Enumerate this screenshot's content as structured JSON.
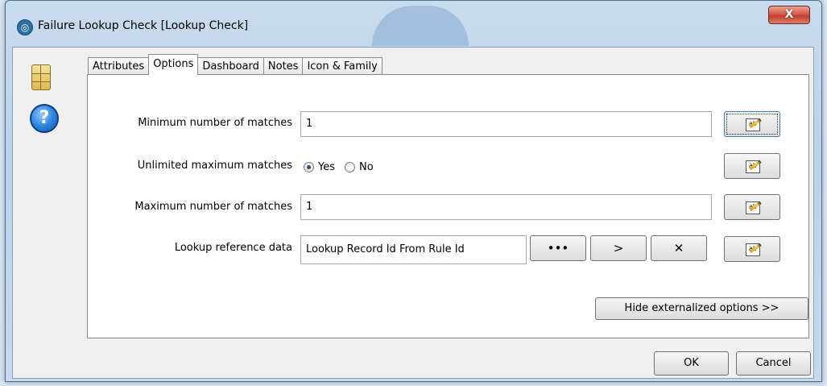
{
  "window": {
    "title": "Failure Lookup Check [Lookup Check]",
    "close_glyph": "X",
    "app_icon": "app-logo-icon"
  },
  "side_icons": {
    "db": "database-table-icon",
    "help": "?"
  },
  "tabs": [
    {
      "label": "Attributes",
      "active": false
    },
    {
      "label": "Options",
      "active": true
    },
    {
      "label": "Dashboard",
      "active": false
    },
    {
      "label": "Notes",
      "active": false
    },
    {
      "label": "Icon & Family",
      "active": false
    }
  ],
  "options": {
    "min_matches": {
      "label": "Minimum number of matches",
      "value": "1"
    },
    "unlimited_max": {
      "label": "Unlimited maximum matches",
      "yes_label": "Yes",
      "no_label": "No",
      "selected": "Yes"
    },
    "max_matches": {
      "label": "Maximum number of matches",
      "value": "1"
    },
    "lookup_ref": {
      "label": "Lookup reference data",
      "value": "Lookup Record Id From Rule Id",
      "browse": "•••",
      "go": ">",
      "clear": "✕"
    },
    "edit_glyph": "ab"
  },
  "hide_externalized": "Hide externalized options >>",
  "footer": {
    "ok": "OK",
    "cancel": "Cancel"
  }
}
